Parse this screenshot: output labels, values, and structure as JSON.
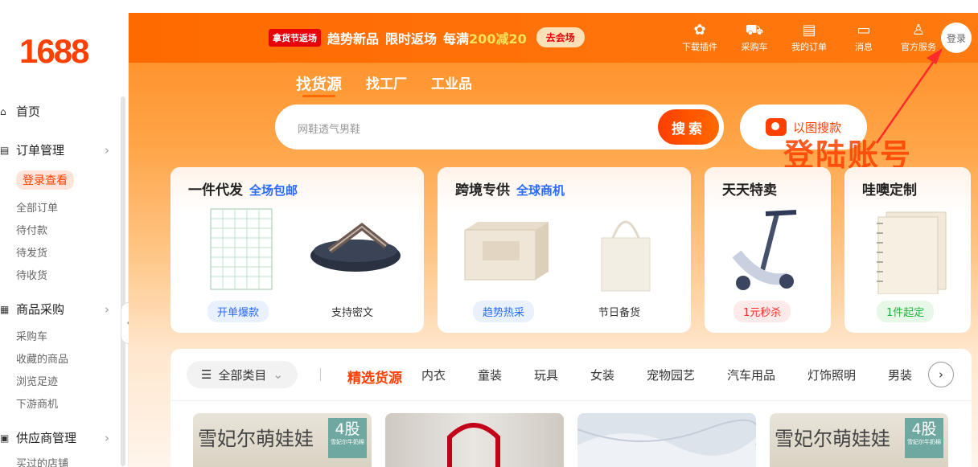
{
  "logo": "1688",
  "sidebar": {
    "home": "首页",
    "orders": {
      "label": "订单管理",
      "login": "登录查看",
      "items": [
        "全部订单",
        "待付款",
        "待发货",
        "待收货"
      ]
    },
    "purchase": {
      "label": "商品采购",
      "items": [
        "采购车",
        "收藏的商品",
        "浏览足迹",
        "下游商机"
      ]
    },
    "supplier": {
      "label": "供应商管理",
      "items": [
        "买过的店铺"
      ]
    }
  },
  "header": {
    "promo_tag": "拿货节返场",
    "promo_text1": "趋势新品",
    "promo_text2": "限时返场",
    "promo_text3": "每满",
    "promo_num": "200减20",
    "promo_button": "去会场",
    "actions": [
      {
        "label": "下载插件",
        "icon": "puzzle-icon"
      },
      {
        "label": "采购车",
        "icon": "cart-icon"
      },
      {
        "label": "我的订单",
        "icon": "clipboard-icon"
      },
      {
        "label": "消息",
        "icon": "message-icon"
      },
      {
        "label": "官方服务",
        "icon": "person-icon"
      }
    ],
    "login": "登录"
  },
  "tabs": [
    "找货源",
    "找工厂",
    "工业品"
  ],
  "search": {
    "placeholder": "网鞋透气男鞋",
    "button": "搜索",
    "image_search": "以图搜款"
  },
  "annotation": "登陆账号",
  "cards": [
    {
      "title": "一件代发",
      "subtitle": "全场包邮",
      "tags": [
        "开单爆款",
        "支持密文"
      ]
    },
    {
      "title": "跨境专供",
      "subtitle": "全球商机",
      "tags": [
        "趋势热采",
        "节日备货"
      ]
    },
    {
      "title": "天天特卖",
      "subtitle": "",
      "tags": [
        "1元秒杀"
      ]
    },
    {
      "title": "哇噢定制",
      "subtitle": "",
      "tags": [
        "1件起定"
      ]
    }
  ],
  "categories": {
    "all": "全部类目",
    "items": [
      "精选货源",
      "内衣",
      "童装",
      "玩具",
      "女装",
      "宠物园艺",
      "汽车用品",
      "灯饰照明",
      "男装"
    ]
  },
  "products": [
    {
      "title": "雪妃尔萌娃娃",
      "badge": "4股",
      "badge_sub": "雪妃尔牛奶棉"
    },
    {
      "title": "",
      "badge": "",
      "badge_sub": ""
    },
    {
      "title": "",
      "badge": "",
      "badge_sub": ""
    },
    {
      "title": "雪妃尔萌娃娃",
      "badge": "4股",
      "badge_sub": "雪妃尔牛奶棉"
    }
  ],
  "colors": {
    "brand": "#ff4000",
    "accent_blue": "#2a6bff"
  }
}
